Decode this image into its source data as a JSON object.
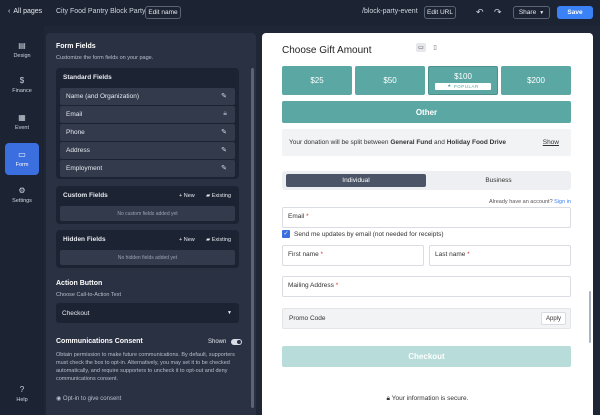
{
  "topbar": {
    "back_label": "All pages",
    "page_title": "City Food Pantry Block Party",
    "edit_name_label": "Edit name",
    "url_path": "/block-party-event",
    "edit_url_label": "Edit URL",
    "share_label": "Share",
    "save_label": "Save"
  },
  "nav": {
    "items": [
      {
        "label": "Design",
        "icon": "brush-icon"
      },
      {
        "label": "Finance",
        "icon": "dollar-icon"
      },
      {
        "label": "Event",
        "icon": "calendar-icon"
      },
      {
        "label": "Form",
        "icon": "form-icon"
      },
      {
        "label": "Settings",
        "icon": "gear-icon"
      }
    ],
    "help_label": "Help"
  },
  "panel": {
    "form_fields_title": "Form Fields",
    "form_fields_sub": "Customize the form fields on your page.",
    "standard_title": "Standard Fields",
    "standard_fields": [
      {
        "label": "Name (and Organization)",
        "icon": "pencil-icon"
      },
      {
        "label": "Email",
        "icon": "lock-icon"
      },
      {
        "label": "Phone",
        "icon": "pencil-icon"
      },
      {
        "label": "Address",
        "icon": "pencil-icon"
      },
      {
        "label": "Employment",
        "icon": "pencil-icon"
      }
    ],
    "custom_title": "Custom Fields",
    "custom_empty": "No custom fields added yet",
    "hidden_title": "Hidden Fields",
    "hidden_empty": "No hidden fields added yet",
    "new_label": "New",
    "existing_label": "Existing",
    "action_title": "Action Button",
    "action_sub": "Choose Call-to-Action Text",
    "action_value": "Checkout",
    "consent_title": "Communications Consent",
    "consent_shown": "Shown",
    "consent_text": "Obtain permission to make future communications. By default, supporters must check the box to opt-in. Alternatively, you may set it to be checked automatically, and require supporters to uncheck it to opt-out and deny communications consent.",
    "optin_label": "Opt-in to give consent"
  },
  "preview": {
    "title": "Choose Gift Amount",
    "amounts": [
      "$25",
      "$50",
      "$100",
      "$200"
    ],
    "popular_label": "POPULAR",
    "other_label": "Other",
    "split_prefix": "Your donation will be split between ",
    "split_fund1": "General Fund",
    "split_and": " and ",
    "split_fund2": "Holiday Food Drive",
    "show_label": "Show",
    "tab_individual": "Individual",
    "tab_business": "Business",
    "login_prefix": "Already have an account? ",
    "login_link": "Sign in",
    "email_label": "Email",
    "updates_label": "Send me updates by email (not needed for receipts)",
    "first_name_label": "First name",
    "last_name_label": "Last name",
    "mailing_label": "Mailing Address",
    "promo_label": "Promo Code",
    "apply_label": "Apply",
    "checkout_label": "Checkout",
    "secure_label": "Your information is secure."
  },
  "colors": {
    "accent_teal": "#5aa7a3",
    "primary_blue": "#3b82f6",
    "nav_active": "#3b6fe0"
  }
}
